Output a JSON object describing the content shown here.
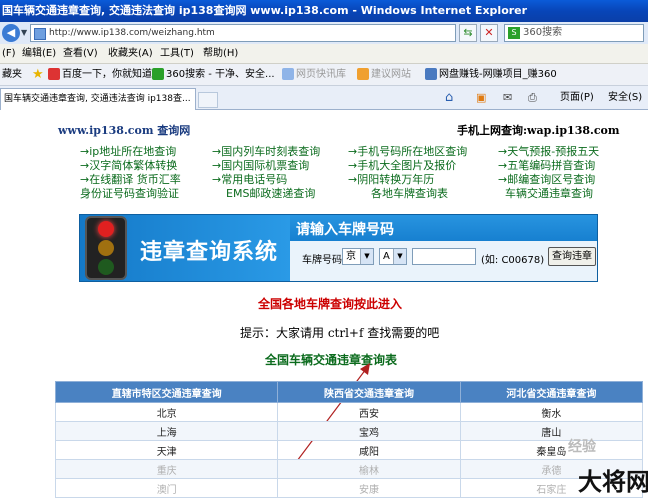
{
  "window": {
    "title": "国车辆交通违章查询, 交通违法查询 ip138查询网 www.ip138.com - Windows Internet Explorer"
  },
  "address_bar": {
    "url": "http://www.ip138.com/weizhang.htm",
    "search_placeholder": "360搜索"
  },
  "menu": [
    "(F)",
    "编辑(E)",
    "查看(V)",
    "收藏夹(A)",
    "工具(T)",
    "帮助(H)"
  ],
  "favorites": {
    "label": "藏夹",
    "items": [
      {
        "label": "百度一下，你就知道"
      },
      {
        "label": "360搜索 - 干净、安全..."
      },
      {
        "label": "网页快讯库"
      },
      {
        "label": "建议网站"
      },
      {
        "label": "网盘赚钱-网赚项目_赚360"
      }
    ]
  },
  "tab": {
    "label": "国车辆交通违章查询, 交通违法查询 ip138查..."
  },
  "command_bar": {
    "page": "页面(P)",
    "safety": "安全(S)"
  },
  "page": {
    "site_name": "www.ip138.com 查询网",
    "mobile_query": "手机上网查询:wap.ip138.com",
    "links": [
      [
        "ip地址所在地查询",
        "国内列车时刻表查询",
        "手机号码所在地区查询",
        "天气预报-预报五天"
      ],
      [
        "汉字简体繁体转换",
        "国内国际机票查询",
        "手机大全图片及报价",
        "五笔编码拼音查询"
      ],
      [
        "在线翻译 货币汇率",
        "常用电话号码",
        "阴阳转换万年历",
        "邮编查询区号查询"
      ],
      [
        "身份证号码查询验证",
        "EMS邮政速递查询",
        "各地车牌查询表",
        "车辆交通违章查询"
      ]
    ],
    "banner": {
      "title": "违章查询系统",
      "prompt": "请输入车牌号码",
      "plate_label": "车牌号码",
      "province": "京",
      "letter": "A",
      "example": "(如: C00678)",
      "button": "查询违章"
    },
    "nationwide": "全国各地车牌查询按此进入",
    "tip": "提示：大家请用 ctrl+f 查找需要的吧",
    "table_title": "全国车辆交通违章查询表",
    "table": {
      "headers": [
        "直辖市特区交通违章查询",
        "陕西省交通违章查询",
        "河北省交通违章查询"
      ],
      "rows": [
        [
          "北京",
          "西安",
          "衡水"
        ],
        [
          "上海",
          "宝鸡",
          "唐山"
        ],
        [
          "天津",
          "咸阳",
          "秦皇岛"
        ],
        [
          "重庆",
          "榆林",
          "承德"
        ],
        [
          "澳门",
          "安康",
          "石家庄"
        ]
      ]
    }
  },
  "watermark": "经验",
  "brand": "大将网"
}
